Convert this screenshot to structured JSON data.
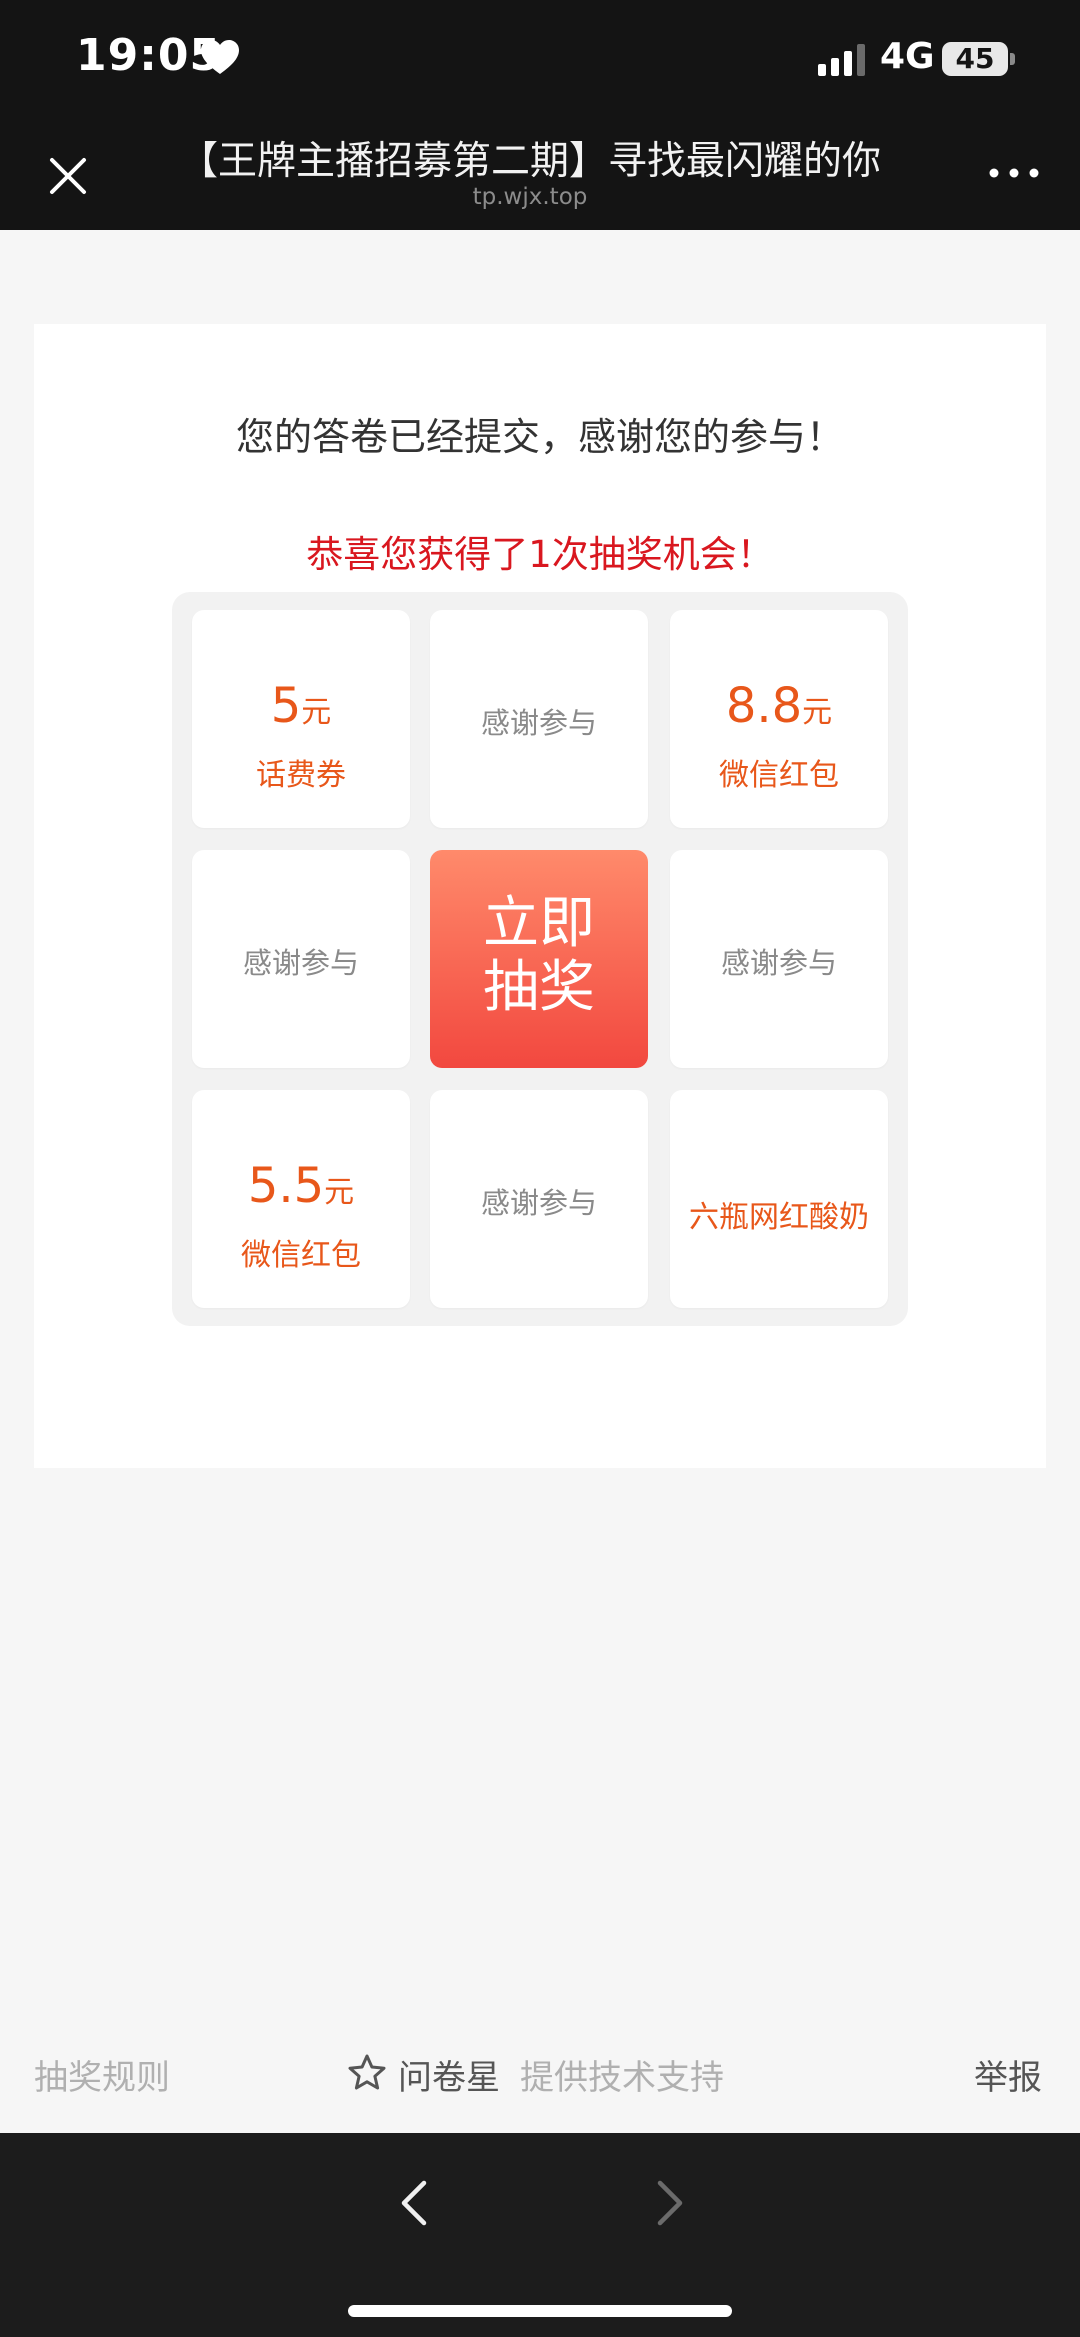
{
  "status_bar": {
    "time": "19:05",
    "network": "4G",
    "battery": "45",
    "icons": [
      "heart-icon",
      "signal-icon",
      "battery-icon"
    ]
  },
  "header": {
    "title": "【王牌主播招募第二期】寻找最闪耀的你",
    "subtitle": "tp.wjx.top",
    "icons": [
      "close-icon",
      "more-icon"
    ]
  },
  "card": {
    "thanks_text": "您的答卷已经提交，感谢您的参与！",
    "congrats_text": "恭喜您获得了1次抽奖机会！",
    "grid": {
      "thanks_label": "感谢参与",
      "prize_5": {
        "amount": "5",
        "unit": "元",
        "name": "话费券"
      },
      "prize_88": {
        "amount": "8.8",
        "unit": "元",
        "name": "微信红包"
      },
      "prize_55": {
        "amount": "5.5",
        "unit": "元",
        "name": "微信红包"
      },
      "prize_yogurt": {
        "name": "六瓶网红酸奶"
      },
      "draw_button": {
        "line1": "立即",
        "line2": "抽奖"
      }
    }
  },
  "footer": {
    "rules": "抽奖规则",
    "brand": "问卷星",
    "support": "提供技术支持",
    "report": "举报",
    "icons": [
      "star-icon"
    ]
  },
  "bottom_nav": {
    "icons": [
      "back-arrow-icon",
      "forward-arrow-icon"
    ]
  },
  "colors": {
    "accent_orange": "#e8571a",
    "congrats_red": "#d9171f",
    "button_top": "#ff8a6b",
    "button_bottom": "#f2483f",
    "dark_bar": "#141414"
  }
}
